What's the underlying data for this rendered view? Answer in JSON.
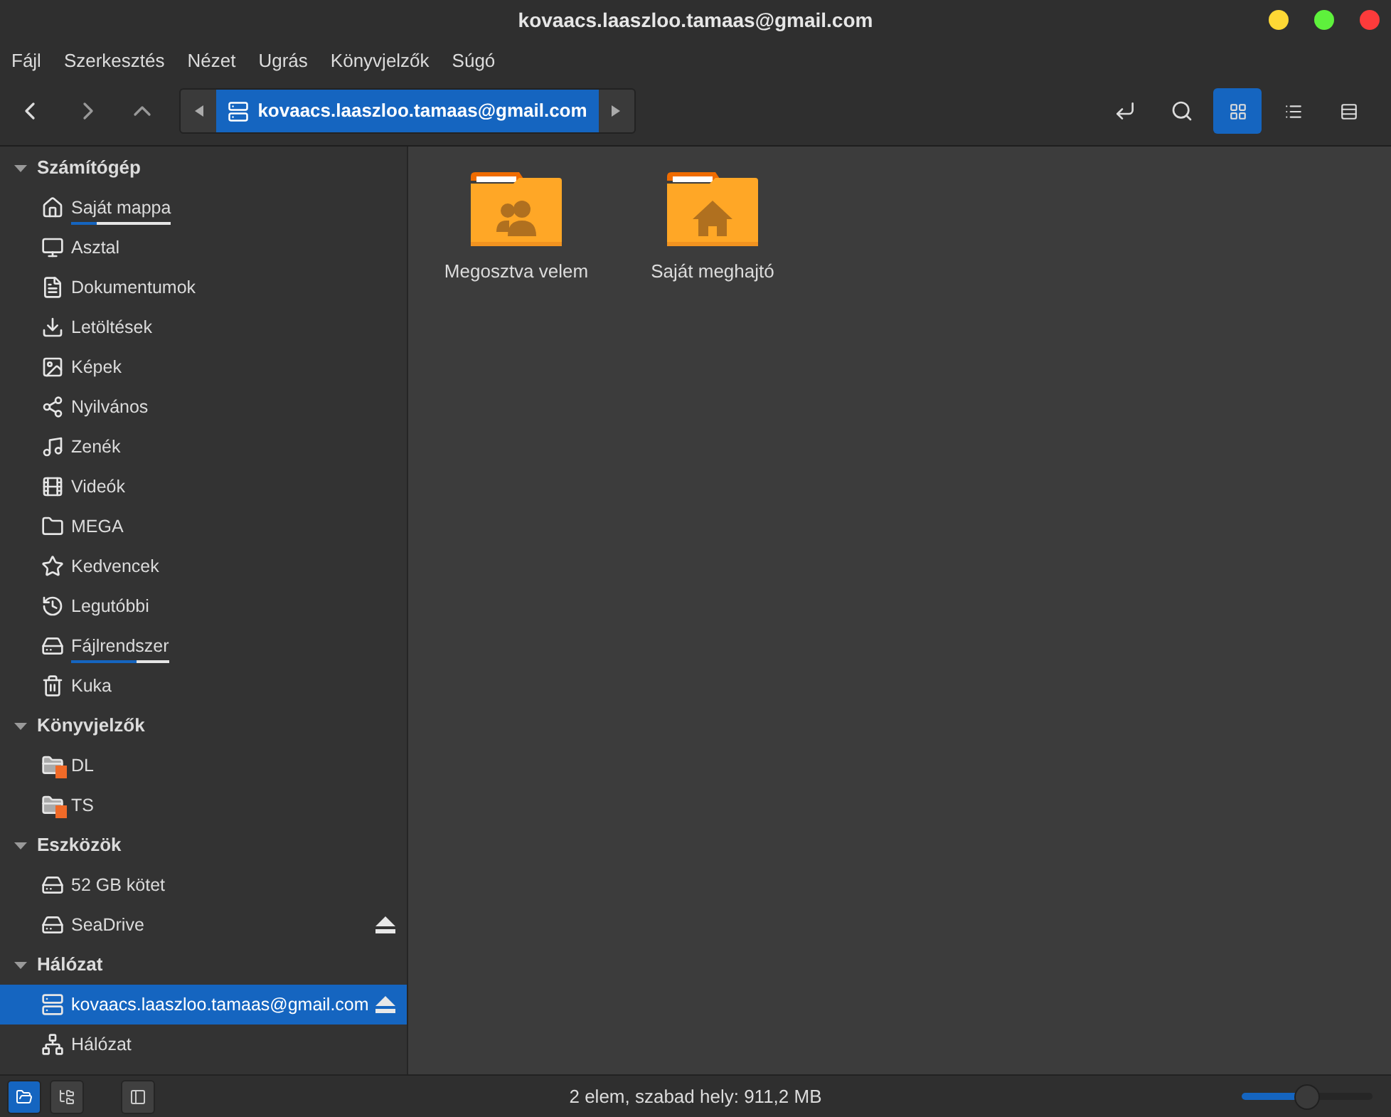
{
  "window": {
    "title": "kovaacs.laaszloo.tamaas@gmail.com"
  },
  "menu": [
    "Fájl",
    "Szerkesztés",
    "Nézet",
    "Ugrás",
    "Könyvjelzők",
    "Súgó"
  ],
  "location": {
    "path": "kovaacs.laaszloo.tamaas@gmail.com"
  },
  "view_buttons": [
    {
      "selected": true
    },
    {
      "selected": false
    },
    {
      "selected": false
    }
  ],
  "sidebar": [
    {
      "title": "Számítógép",
      "expanded": true,
      "items": [
        {
          "label": "Saját mappa",
          "selected": false,
          "eject": false,
          "level": 0.25
        },
        {
          "label": "Asztal",
          "selected": false,
          "eject": false
        },
        {
          "label": "Dokumentumok",
          "selected": false,
          "eject": false
        },
        {
          "label": "Letöltések",
          "selected": false,
          "eject": false
        },
        {
          "label": "Képek",
          "selected": false,
          "eject": false
        },
        {
          "label": "Nyilvános",
          "selected": false,
          "eject": false
        },
        {
          "label": "Zenék",
          "selected": false,
          "eject": false
        },
        {
          "label": "Videók",
          "selected": false,
          "eject": false
        },
        {
          "label": "MEGA",
          "selected": false,
          "eject": false
        },
        {
          "label": "Kedvencek",
          "selected": false,
          "eject": false
        },
        {
          "label": "Legutóbbi",
          "selected": false,
          "eject": false
        },
        {
          "label": "Fájlrendszer",
          "selected": false,
          "eject": false,
          "level": 0.67
        },
        {
          "label": "Kuka",
          "selected": false,
          "eject": false
        }
      ]
    },
    {
      "title": "Könyvjelzők",
      "expanded": true,
      "items": [
        {
          "label": "DL",
          "selected": false,
          "eject": false
        },
        {
          "label": "TS",
          "selected": false,
          "eject": false
        }
      ]
    },
    {
      "title": "Eszközök",
      "expanded": true,
      "items": [
        {
          "label": "52 GB kötet",
          "selected": false,
          "eject": false
        },
        {
          "label": "SeaDrive",
          "selected": false,
          "eject": true
        }
      ]
    },
    {
      "title": "Hálózat",
      "expanded": true,
      "items": [
        {
          "label": "kovaacs.laaszloo.tamaas@gmail.com",
          "selected": true,
          "eject": true
        },
        {
          "label": "Hálózat",
          "selected": false,
          "eject": false
        }
      ]
    }
  ],
  "files": [
    {
      "name": "Megosztva velem"
    },
    {
      "name": "Saját meghajtó"
    }
  ],
  "bottom_buttons": [
    {
      "selected": true
    },
    {
      "selected": false
    },
    {
      "selected": false
    }
  ],
  "status_bar": {
    "text": "2 elem, szabad hely: 911,2 MB"
  },
  "zoom": {
    "level": 0.5
  }
}
